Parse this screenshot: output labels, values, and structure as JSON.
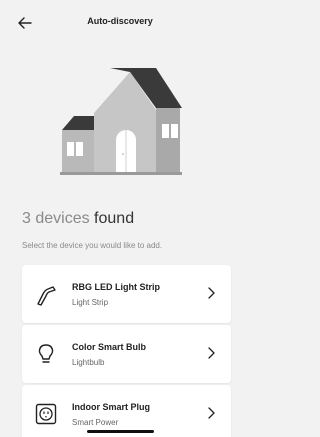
{
  "header": {
    "title": "Auto-discovery",
    "back_icon": "arrow-left-icon"
  },
  "illustration": {
    "icon": "house-icon"
  },
  "results": {
    "count": "3 devices",
    "found_label": "found",
    "subtitle": "Select the device you would like to add."
  },
  "devices": [
    {
      "name": "RBG LED Light Strip",
      "type": "Light Strip",
      "icon": "light-strip-icon"
    },
    {
      "name": "Color Smart Bulb",
      "type": "Lightbulb",
      "icon": "lightbulb-icon"
    },
    {
      "name": "Indoor Smart Plug",
      "type": "Smart Power",
      "icon": "smart-plug-icon"
    }
  ]
}
